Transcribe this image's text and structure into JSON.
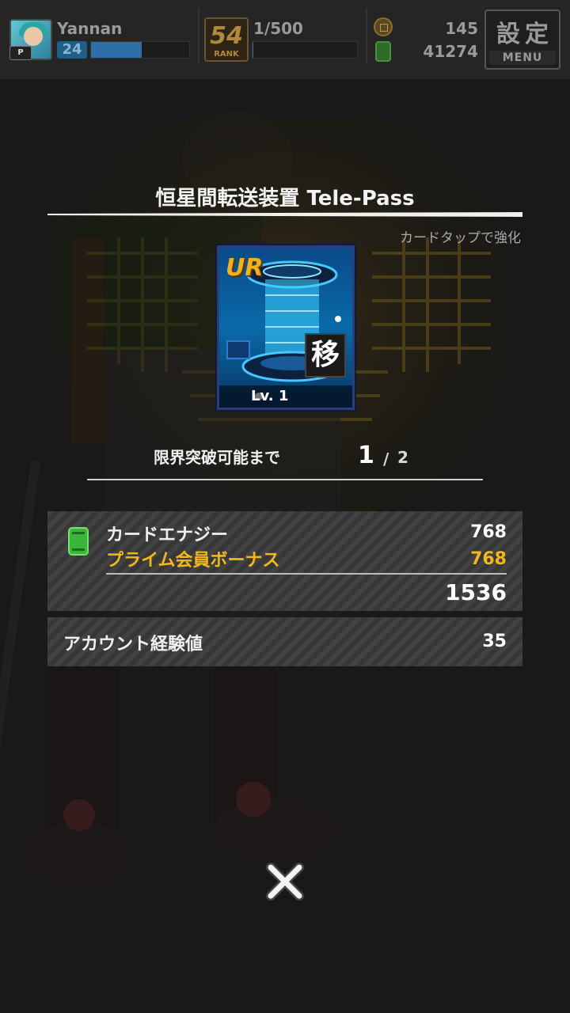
{
  "header": {
    "username": "Yannan",
    "level": "24",
    "p_badge": "P",
    "rank_number": "54",
    "rank_word": "RANK",
    "rank_progress": "1/500",
    "coins": "145",
    "energy": "41274",
    "menu_kanji": "設定",
    "menu_label": "MENU",
    "exp_fill_fraction": 0.52,
    "rank_fill_fraction": 0.002
  },
  "modal": {
    "title": "恒星間転送装置 Tele-Pass",
    "tap_hint": "カードタップで強化",
    "card": {
      "rarity": "UR",
      "type_kanji": "移",
      "level": "Lv. 1"
    },
    "limit_break": {
      "label": "限界突破可能まで",
      "current": "1",
      "separator": "/",
      "max": "2"
    },
    "energy_panel": {
      "card_energy_label": "カードエナジー",
      "card_energy_value": "768",
      "bonus_label": "プライム会員ボーナス",
      "bonus_value": "768",
      "total_value": "1536"
    },
    "account_exp": {
      "label": "アカウント経験値",
      "value": "35"
    }
  },
  "colors": {
    "bonus_text": "#f2b81c",
    "rarity": "#f2b01e",
    "energy_can": "#3bb53b",
    "panel_bg": "#3a3a3a"
  },
  "icons": {
    "close": "close-x-icon",
    "energy": "energy-can-icon",
    "coin": "coin-icon"
  }
}
